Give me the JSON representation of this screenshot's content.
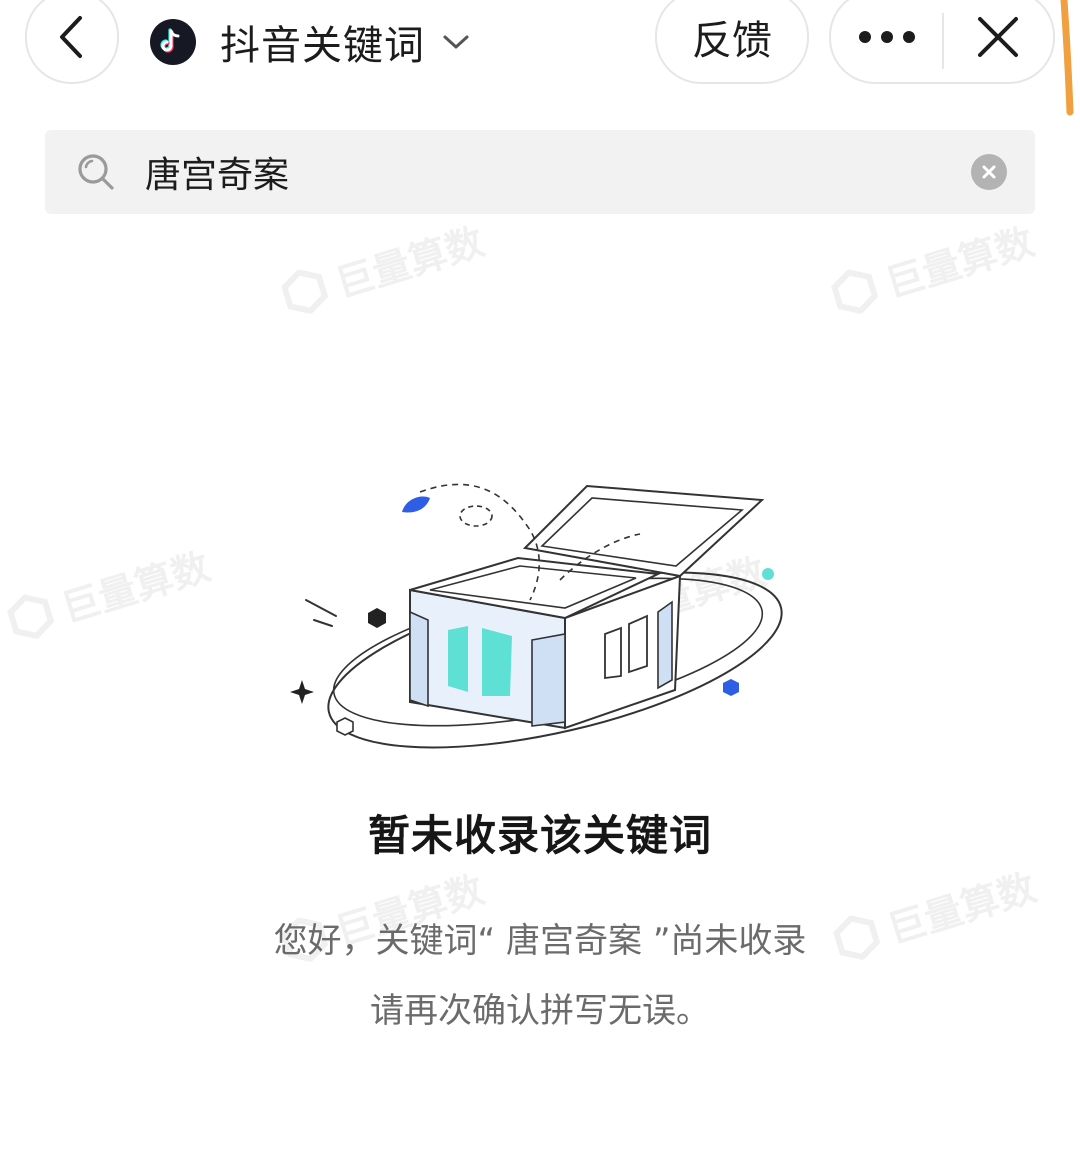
{
  "header": {
    "app_title": "抖音关键词",
    "feedback_label": "反馈",
    "app_logo_icon": "douyin-logo-icon",
    "back_icon": "chevron-left-icon",
    "dropdown_icon": "chevron-down-icon",
    "more_icon": "more-dots-icon",
    "close_icon": "close-icon"
  },
  "search": {
    "value": "唐宫奇案",
    "search_icon": "search-icon",
    "clear_icon": "clear-circle-icon"
  },
  "watermark": {
    "text": "巨量算数"
  },
  "empty_state": {
    "title": "暂未收录该关键词",
    "line1_prefix": "您好，关键词“",
    "keyword": " 唐宫奇案 ",
    "line1_suffix": "”尚未收录",
    "line2": "请再次确认拼写无误。"
  },
  "colors": {
    "accent_cyan": "#5fe0d4",
    "accent_blue": "#2e5ee6",
    "box_fill": "#e8f1fb",
    "orange_mark": "#f0a040"
  }
}
